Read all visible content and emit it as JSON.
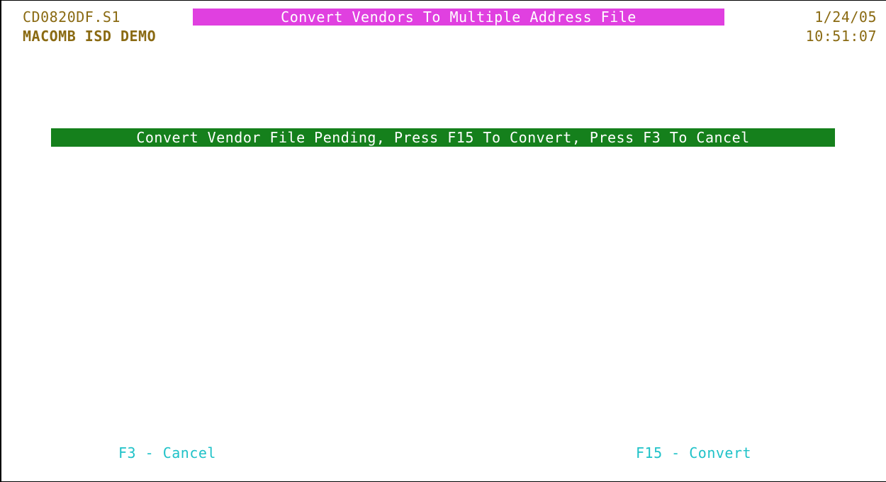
{
  "header": {
    "program_id": "CD0820DF.S1",
    "title": "Convert Vendors To Multiple Address File",
    "date": "1/24/05",
    "org_name": "MACOMB ISD DEMO",
    "time": "10:51:07"
  },
  "status_message": "Convert Vendor File Pending, Press F15 To Convert, Press F3 To Cancel",
  "function_keys": {
    "cancel": "F3 - Cancel",
    "convert": "F15 - Convert"
  },
  "colors": {
    "title_bar": "#e040e0",
    "status_bar": "#15801c",
    "header_text": "#8a6a12",
    "function_key_text": "#1fc2c8"
  }
}
